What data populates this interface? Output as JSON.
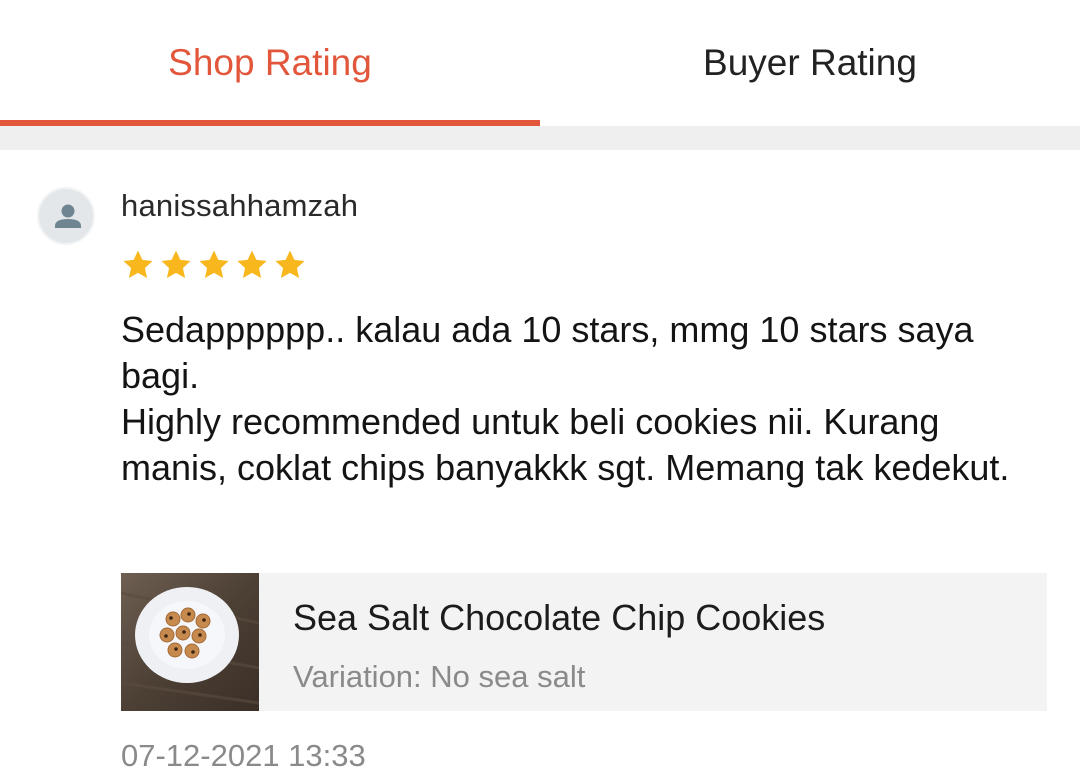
{
  "tabs": [
    {
      "label": "Shop Rating",
      "active": true
    },
    {
      "label": "Buyer Rating",
      "active": false
    }
  ],
  "colors": {
    "accent": "#e2573b",
    "star": "#f7b71d",
    "divider": "#efefef",
    "product_bg": "#f3f3f3"
  },
  "review": {
    "avatar_icon": "user-avatar-icon",
    "username": "hanissahhamzah",
    "rating": 5,
    "rating_max": 5,
    "comment": "Sedapppppp.. kalau ada 10 stars, mmg 10 stars saya bagi.\nHighly recommended untuk beli cookies nii. Kurang manis, coklat chips banyakkk sgt. Memang tak kedekut.",
    "product": {
      "name": "Sea Salt Chocolate Chip Cookies",
      "variation": "Variation: No sea salt"
    },
    "timestamp": "07-12-2021 13:33"
  }
}
